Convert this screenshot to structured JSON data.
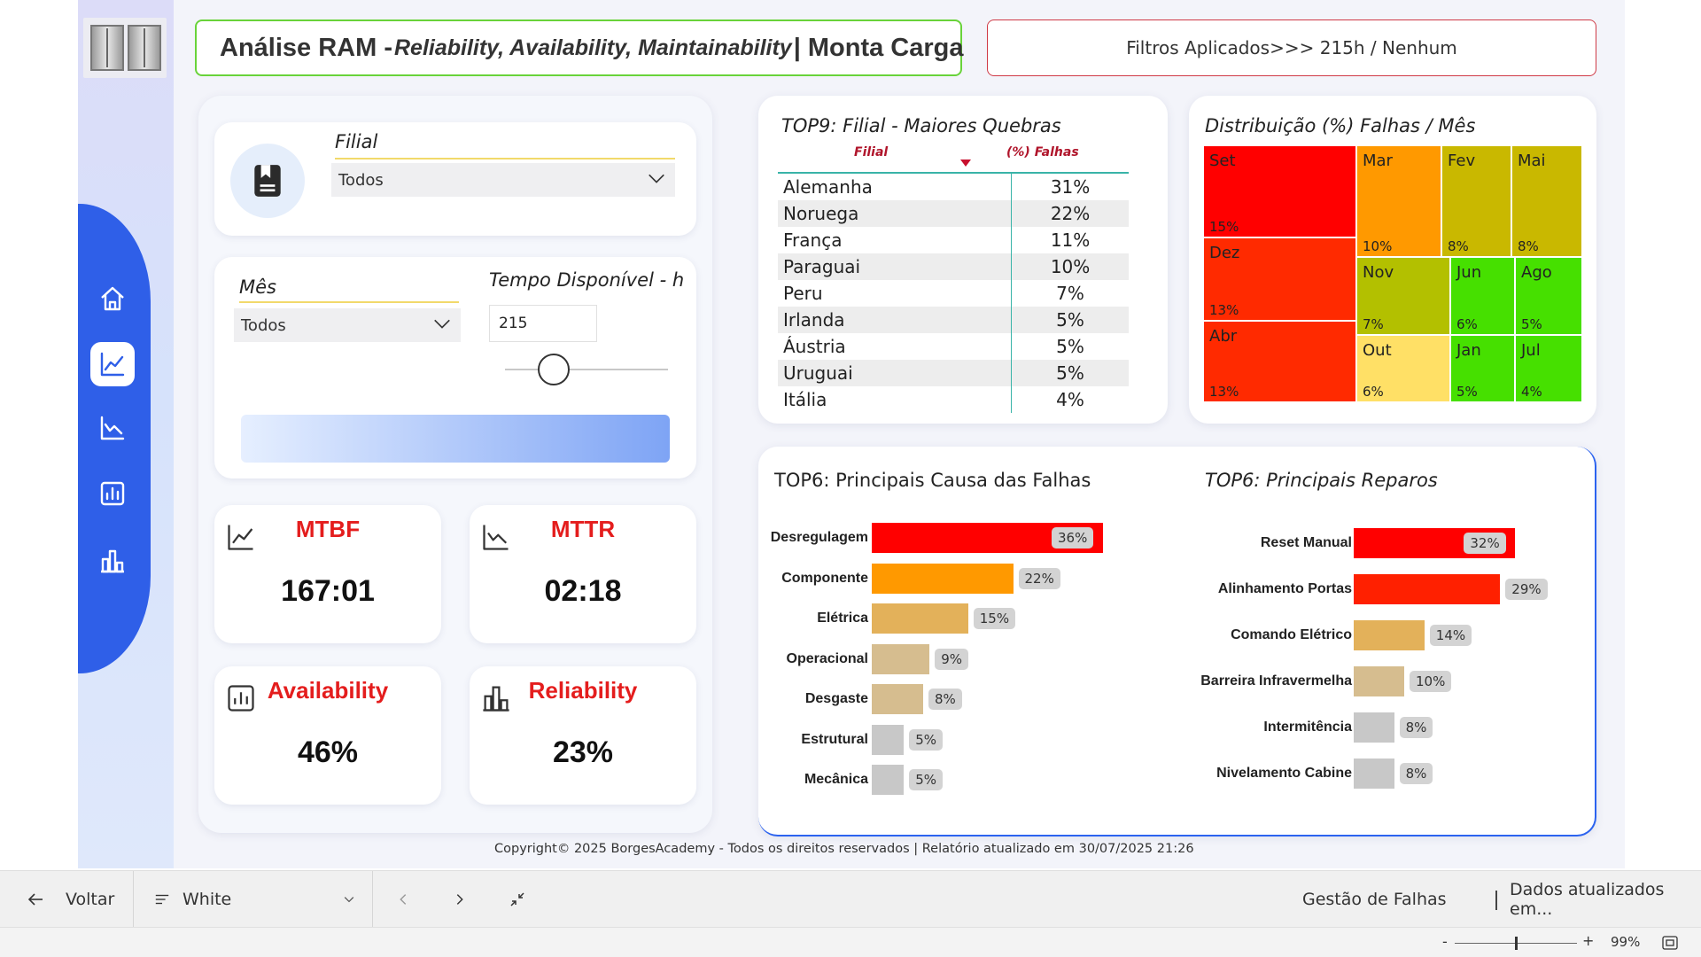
{
  "header": {
    "title_prefix": "Análise RAM - ",
    "title_italic": "Reliability, Availability, Maintainability",
    "title_suffix": "| Monta Carga",
    "filters_text": "Filtros Aplicados>>> 215h / Nenhum"
  },
  "filters": {
    "filial_label": "Filial",
    "filial_value": "Todos",
    "mes_label": "Mês",
    "mes_value": "Todos",
    "tempo_label": "Tempo Disponível - h",
    "tempo_value": "215",
    "slider_fraction": 0.3
  },
  "kpis": {
    "mtbf_label": "MTBF",
    "mtbf_value": "167:01",
    "mttr_label": "MTTR",
    "mttr_value": "02:18",
    "availability_label": "Availability",
    "availability_value": "46%",
    "reliability_label": "Reliability",
    "reliability_value": "23%"
  },
  "top9": {
    "title": "TOP9: Filial - Maiores Quebras",
    "col_filial": "Filial",
    "col_falhas": "(%) Falhas",
    "rows": [
      {
        "name": "Alemanha",
        "value": "31%"
      },
      {
        "name": "Noruega",
        "value": "22%"
      },
      {
        "name": "França",
        "value": "11%"
      },
      {
        "name": "Paraguai",
        "value": "10%"
      },
      {
        "name": "Peru",
        "value": "7%"
      },
      {
        "name": "Irlanda",
        "value": "5%"
      },
      {
        "name": "Áustria",
        "value": "5%"
      },
      {
        "name": "Uruguai",
        "value": "5%"
      },
      {
        "name": "Itália",
        "value": "4%"
      }
    ]
  },
  "distribution": {
    "title": "Distribuição (%) Falhas / Mês",
    "cells": [
      {
        "month": "Set",
        "pct": "15%",
        "color": "#ff0000"
      },
      {
        "month": "Dez",
        "pct": "13%",
        "color": "#ff2a00"
      },
      {
        "month": "Abr",
        "pct": "13%",
        "color": "#ff2a00"
      },
      {
        "month": "Mar",
        "pct": "10%",
        "color": "#ff9900"
      },
      {
        "month": "Fev",
        "pct": "8%",
        "color": "#c9b800"
      },
      {
        "month": "Mai",
        "pct": "8%",
        "color": "#c9b800"
      },
      {
        "month": "Nov",
        "pct": "7%",
        "color": "#b3c000"
      },
      {
        "month": "Jun",
        "pct": "6%",
        "color": "#46e000"
      },
      {
        "month": "Ago",
        "pct": "5%",
        "color": "#46e000"
      },
      {
        "month": "Out",
        "pct": "6%",
        "color": "#ffe066"
      },
      {
        "month": "Jan",
        "pct": "5%",
        "color": "#46e000"
      },
      {
        "month": "Jul",
        "pct": "4%",
        "color": "#46e000"
      }
    ]
  },
  "causes": {
    "title": "TOP6: Principais Causa das Falhas",
    "items": [
      {
        "label": "Desregulagem",
        "value": 36,
        "pct": "36%",
        "color": "#ff0000"
      },
      {
        "label": "Componente",
        "value": 22,
        "pct": "22%",
        "color": "#ff9900"
      },
      {
        "label": "Elétrica",
        "value": 15,
        "pct": "15%",
        "color": "#e3b15a"
      },
      {
        "label": "Operacional",
        "value": 9,
        "pct": "9%",
        "color": "#d6bd8f"
      },
      {
        "label": "Desgaste",
        "value": 8,
        "pct": "8%",
        "color": "#d6bd8f"
      },
      {
        "label": "Estrutural",
        "value": 5,
        "pct": "5%",
        "color": "#c8c8c8"
      },
      {
        "label": "Mecânica",
        "value": 5,
        "pct": "5%",
        "color": "#c8c8c8"
      }
    ]
  },
  "repairs": {
    "title": "TOP6: Principais Reparos",
    "items": [
      {
        "label": "Reset Manual",
        "value": 32,
        "pct": "32%",
        "color": "#ff0000"
      },
      {
        "label": "Alinhamento Portas",
        "value": 29,
        "pct": "29%",
        "color": "#ff2000"
      },
      {
        "label": "Comando Elétrico",
        "value": 14,
        "pct": "14%",
        "color": "#e3b15a"
      },
      {
        "label": "Barreira Infravermelha",
        "value": 10,
        "pct": "10%",
        "color": "#d6bd8f"
      },
      {
        "label": "Intermitência",
        "value": 8,
        "pct": "8%",
        "color": "#c8c8c8"
      },
      {
        "label": "Nivelamento Cabine",
        "value": 8,
        "pct": "8%",
        "color": "#c8c8c8"
      }
    ]
  },
  "footer": {
    "copyright": "Copyright© 2025 BorgesAcademy - Todos os direitos reservados  |  Relatório atualizado em 30/07/2025 21:26"
  },
  "toolbar": {
    "back_label": "Voltar",
    "theme_label": "White",
    "page_name": "Gestão de Falhas",
    "updated_label": "Dados atualizados em..."
  },
  "status": {
    "zoom_minus": "-",
    "zoom_plus": "+",
    "zoom_level": "99%",
    "zoom_fraction": 0.5
  },
  "icons": {
    "nav": [
      "home-icon",
      "line-chart-icon",
      "trend-chart-icon",
      "bar-chart-icon",
      "column-chart-icon"
    ]
  }
}
